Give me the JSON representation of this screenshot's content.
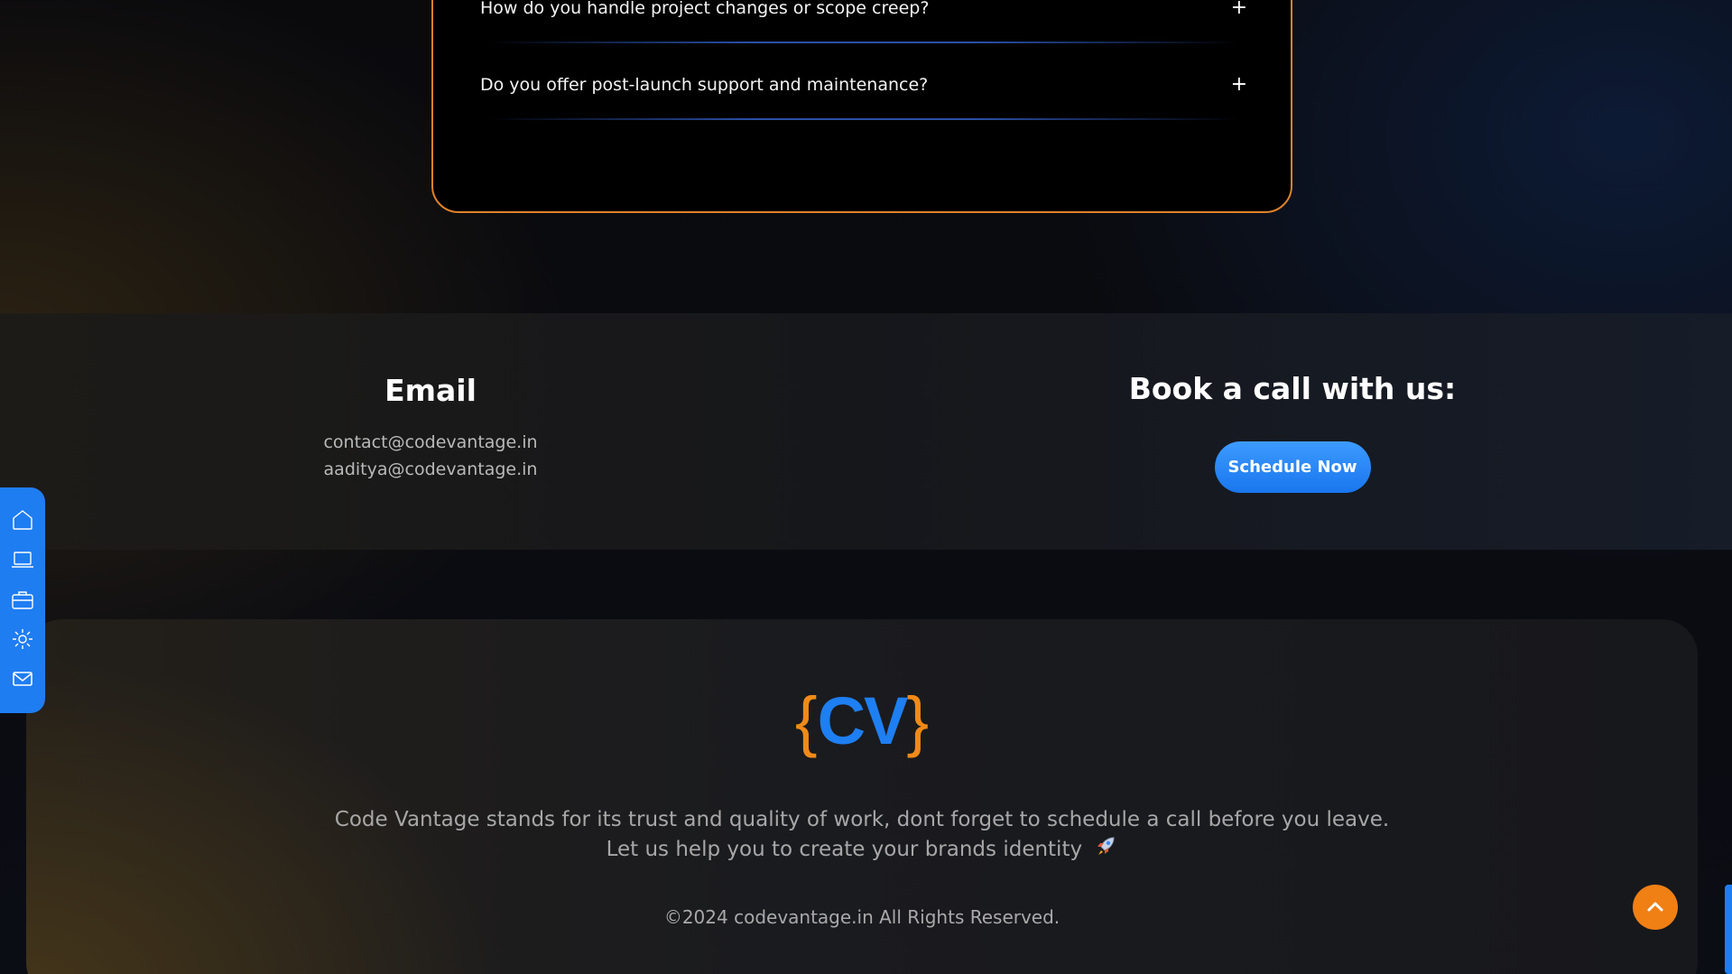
{
  "faq": {
    "items": [
      {
        "question": "How do you handle project changes or scope creep?",
        "toggle": "+"
      },
      {
        "question": "Do you offer post-launch support and maintenance?",
        "toggle": "+"
      }
    ]
  },
  "contact": {
    "email_heading": "Email",
    "emails": [
      "contact@codevantage.in",
      "aaditya@codevantage.in"
    ],
    "call_heading": "Book a call with us:",
    "schedule_label": "Schedule Now"
  },
  "footer": {
    "logo": {
      "left_brace": "{",
      "letters": "CV",
      "right_brace": "}"
    },
    "tagline_line1": "Code Vantage stands for its trust and quality of work, dont forget to schedule a call before you leave.",
    "tagline_line2": "Let us help you to create your brands identity",
    "copyright": "©2024 codevantage.in All Rights Reserved."
  },
  "side_nav": {
    "icons": [
      "home-icon",
      "laptop-icon",
      "briefcase-icon",
      "gear-icon",
      "mail-icon"
    ]
  },
  "colors": {
    "accent_blue": "#1f7df2",
    "accent_orange": "#f08a18",
    "faq_border": "#e0822a"
  }
}
